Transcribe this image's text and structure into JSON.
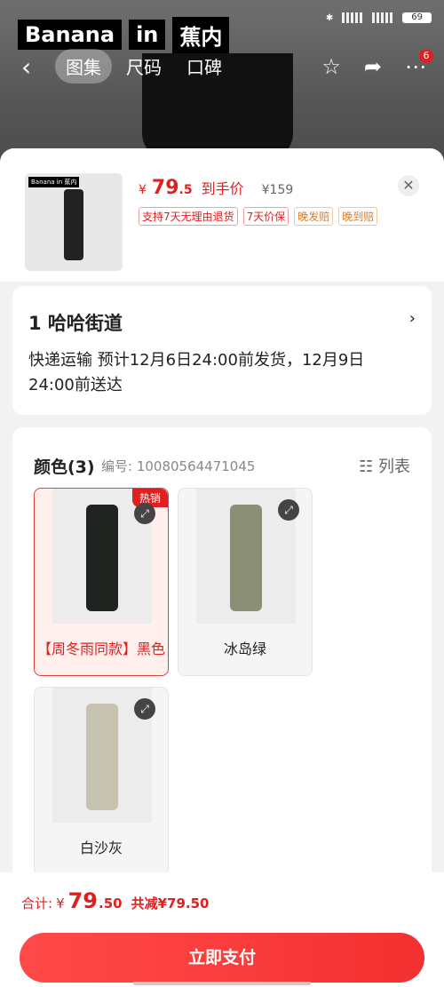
{
  "status": {
    "battery": "69"
  },
  "brand": {
    "part1": "Banana",
    "part2": "in",
    "part3": "蕉内"
  },
  "nav": {
    "tabs": [
      "图集",
      "尺码",
      "口碑"
    ],
    "badge": "6"
  },
  "product": {
    "price_symbol": "¥",
    "price_int": "79",
    "price_dec": ".5",
    "price_label": "到手价",
    "original_price": "¥159",
    "services": [
      "支持7天无理由退货",
      "7天价保",
      "晚发赔",
      "晚到赔"
    ],
    "thumb_logo": "Banana  in  蕉内"
  },
  "address": {
    "name": "1  哈哈街道",
    "delivery": "快递运输 预计12月6日24:00前发货，12月9日24:00前送达"
  },
  "colors": {
    "title": "颜色(3)",
    "code": "编号: 10080564471045",
    "list_label": "列表",
    "options": [
      {
        "label": "【周冬雨同款】黑色",
        "hot": "热销",
        "color": "#1f2421"
      },
      {
        "label": "冰岛绿",
        "color": "#8a8f76"
      },
      {
        "label": "白沙灰",
        "color": "#c6c2b2"
      }
    ]
  },
  "footer": {
    "total_label": "合计:",
    "total_symbol": "¥",
    "total_int": "79",
    "total_dec": ".50",
    "saving": "共减¥79.50",
    "pay_button": "立即支付"
  }
}
